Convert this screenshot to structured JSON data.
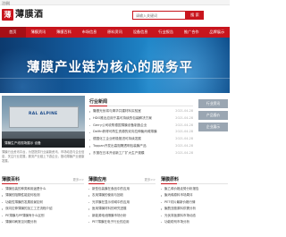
{
  "topbar": {
    "left_text": "注册|"
  },
  "header": {
    "logo_char": "薄",
    "logo_text": "薄膜酒",
    "search_placeholder": "请输入关键词",
    "search_button": "搜 索"
  },
  "nav": [
    {
      "label": "首页",
      "active": true
    },
    {
      "label": "薄膜资讯"
    },
    {
      "label": "薄膜百科"
    },
    {
      "label": "市场信息"
    },
    {
      "label": "原料资讯"
    },
    {
      "label": "设备信息"
    },
    {
      "label": "行业报告"
    },
    {
      "label": "推广合作"
    },
    {
      "label": "品牌展示"
    }
  ],
  "banner": {
    "slogan": "薄膜产业链为核心的服务平"
  },
  "photo": {
    "machine_label": "RAL ALPINE",
    "caption": "薄膜生产线现场展示 设备"
  },
  "description": "薄膜行业资讯平台，为您提供行业最新资讯、市场动态与企业信息，关注行业发展，服务产业链上下游企业，推动薄膜产业健康发展。",
  "news": {
    "title": "行业新闻",
    "items": [
      {
        "text": "隆基光伏将与清华共建材料实验室",
        "date": "2021-04-28"
      },
      {
        "text": "HDO推出应用于高可持续的包装解决方案",
        "date": "2021-04-28"
      },
      {
        "text": "Gerry公司收购德国薄膜设备制造企业",
        "date": "2021-04-28"
      },
      {
        "text": "Delfin获得可再生资源的双向拉伸聚丙烯薄膜",
        "date": "2021-04-28"
      },
      {
        "text": "德国化工企业积极推进可持续发展",
        "date": "2021-04-28"
      },
      {
        "text": "Toppan开发出高阻隔透明包装膜产品",
        "date": "2021-04-28"
      },
      {
        "text": "东丽在日本开设新工厂扩大生产规模",
        "date": "2021-04-28"
      }
    ]
  },
  "side_buttons": [
    "行业资讯",
    "产品报价",
    "企业展示"
  ],
  "bottom": [
    {
      "title": "薄膜百科",
      "more": "更多>>",
      "items": [
        "薄膜包装的种类和用途是什么",
        "薄膜的阻隔性能如何检测",
        "功能性薄膜的发展前景如何",
        "双向拉伸薄膜的加工工艺流程介绍",
        "PE薄膜与PP薄膜有什么区别",
        "薄膜印刷常见问题分析"
      ]
    },
    {
      "title": "薄膜应用",
      "more": "更多>>",
      "items": [
        "新型包装膜在食品中的应用",
        "农用薄膜的使用与回收",
        "光学膜在显示领域中的应用",
        "医用薄膜材料的研究进展",
        "新能源电池隔膜市场分析",
        "PET薄膜在电子行业的应用"
      ]
    },
    {
      "title": "薄膜原料",
      "more": "",
      "items": [
        "聚乙烯价格走势分析报告",
        "聚丙烯原料市场周评",
        "PET切片最新价格行情",
        "聚酰亚胺原料供需分析",
        "光伏背板原料市场动态",
        "功能助剂市场分析"
      ]
    }
  ]
}
